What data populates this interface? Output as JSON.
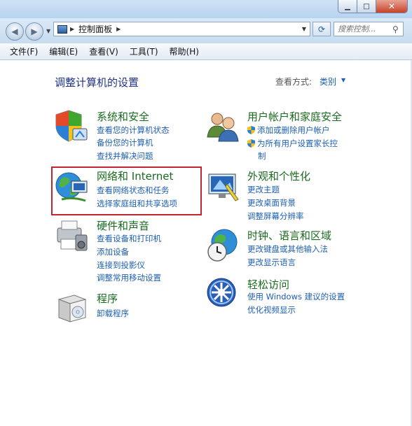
{
  "window": {
    "minimize_icon": "minimize-icon",
    "maximize_icon": "maximize-icon",
    "close_icon": "close-icon"
  },
  "address": {
    "crumb": "控制面板",
    "search_placeholder": "搜索控制..."
  },
  "menu": [
    "文件(F)",
    "编辑(E)",
    "查看(V)",
    "工具(T)",
    "帮助(H)"
  ],
  "page_title": "调整计算机的设置",
  "view_by": {
    "label": "查看方式:",
    "value": "类别"
  },
  "categories": [
    {
      "title": "系统和安全",
      "links": [
        "查看您的计算机状态",
        "备份您的计算机",
        "查找并解决问题"
      ]
    },
    {
      "title": "网络和 Internet",
      "links": [
        "查看网络状态和任务",
        "选择家庭组和共享选项"
      ]
    },
    {
      "title": "硬件和声音",
      "links": [
        "查看设备和打印机",
        "添加设备",
        "连接到投影仪",
        "调整常用移动设置"
      ]
    },
    {
      "title": "程序",
      "links": [
        "卸载程序"
      ]
    },
    {
      "title": "用户帐户和家庭安全",
      "links": [
        "添加或删除用户帐户",
        "为所有用户设置家长控",
        "制"
      ]
    },
    {
      "title": "外观和个性化",
      "links": [
        "更改主题",
        "更改桌面背景",
        "调整屏幕分辨率"
      ]
    },
    {
      "title": "时钟、语言和区域",
      "links": [
        "更改键盘或其他输入法",
        "更改显示语言"
      ]
    },
    {
      "title": "轻松访问",
      "links": [
        "使用 Windows 建议的设置",
        "优化视频显示"
      ]
    }
  ],
  "colors": {
    "category_title": "#196b1f",
    "link": "#1d5fb0",
    "highlight_border": "#c0262d",
    "page_title": "#1e3287"
  }
}
